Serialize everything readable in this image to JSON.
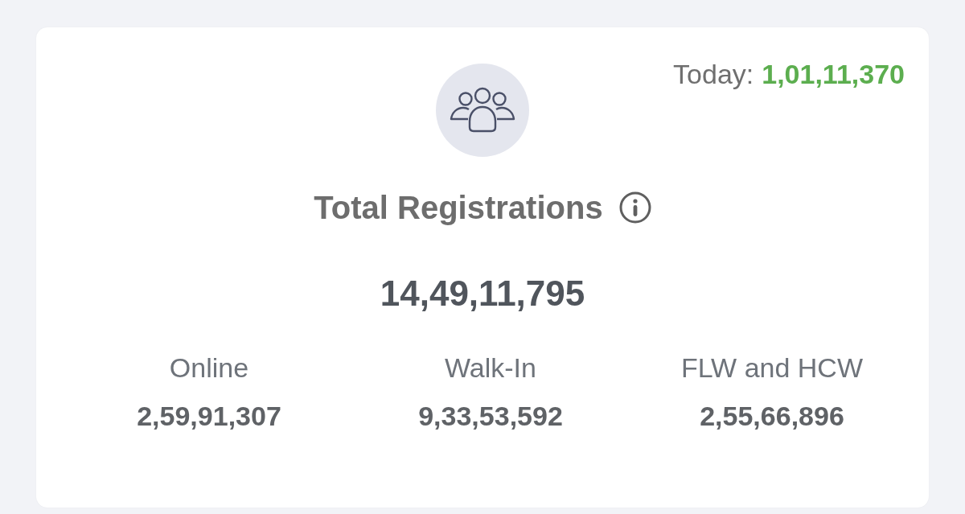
{
  "today": {
    "label": "Today:",
    "value": "1,01,11,370"
  },
  "title": "Total Registrations",
  "total": "14,49,11,795",
  "breakdown": [
    {
      "label": "Online",
      "value": "2,59,91,307"
    },
    {
      "label": "Walk-In",
      "value": "9,33,53,592"
    },
    {
      "label": "FLW and HCW",
      "value": "2,55,66,896"
    }
  ]
}
